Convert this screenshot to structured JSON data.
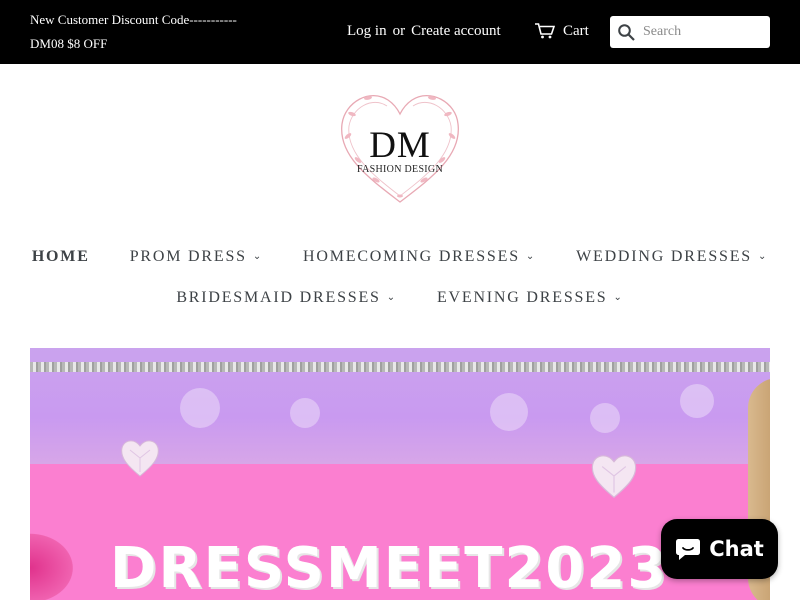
{
  "announcement": {
    "line1": "New Customer Discount Code-----------",
    "line2": "DM08 $8 OFF"
  },
  "account": {
    "login_label": "Log in",
    "or_label": "or",
    "create_label": "Create account"
  },
  "cart": {
    "label": "Cart",
    "icon": "cart-icon"
  },
  "search": {
    "placeholder": "Search",
    "icon": "search-icon"
  },
  "logo": {
    "initials": "DM",
    "subtitle": "FASHION DESIGN"
  },
  "nav": {
    "row1": [
      {
        "label": "HOME",
        "active": true
      },
      {
        "label": "PROM DRESS",
        "dropdown": true
      },
      {
        "label": "HOMECOMING DRESSES",
        "dropdown": true
      },
      {
        "label": "WEDDING DRESSES",
        "dropdown": true
      }
    ],
    "row2": [
      {
        "label": "BRIDESMAID DRESSES",
        "dropdown": true
      },
      {
        "label": "EVENING DRESSES",
        "dropdown": true
      }
    ]
  },
  "hero": {
    "title": "DRESSMEET2023"
  },
  "chat": {
    "label": "Chat",
    "icon": "chat-bubble-icon"
  },
  "colors": {
    "topbar_bg": "#000000",
    "nav_text": "#3d4246",
    "hero_pink": "#fb7fd0",
    "hero_lavender": "#caa3ee",
    "logo_accent": "#e8a9b4"
  }
}
